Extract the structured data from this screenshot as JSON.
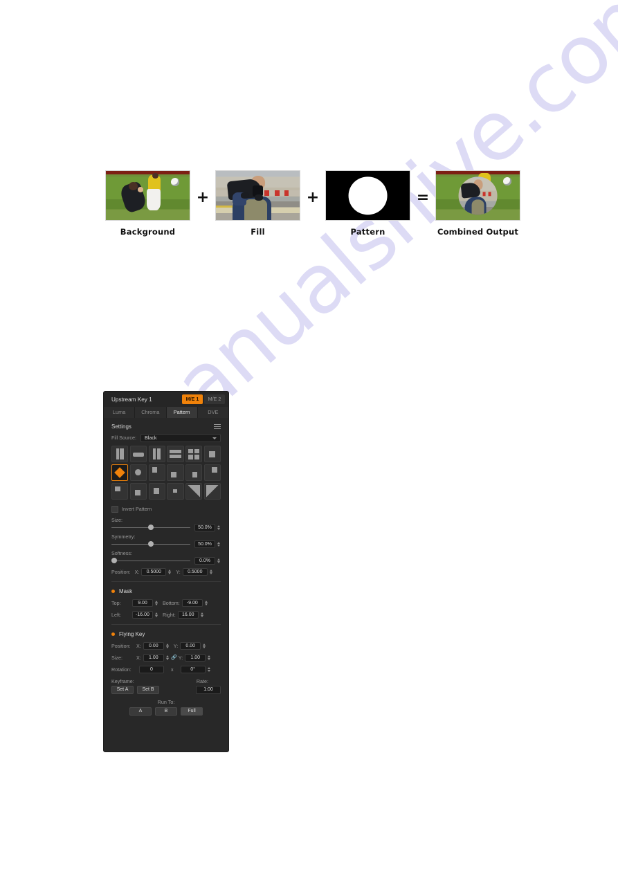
{
  "watermark": {
    "text": "manualshive.com"
  },
  "diagram": {
    "items": [
      {
        "caption": "Background",
        "image": "soccer-background-thumbnail"
      },
      {
        "caption": "Fill",
        "image": "cameraman-fill-thumbnail"
      },
      {
        "caption": "Pattern",
        "image": "circle-pattern-thumbnail"
      },
      {
        "caption": "Combined Output",
        "image": "combined-output-thumbnail"
      }
    ],
    "operators": [
      "+",
      "+",
      "="
    ]
  },
  "panel": {
    "title": "Upstream Key 1",
    "me_buttons": [
      {
        "label": "M/E 1",
        "active": true
      },
      {
        "label": "M/E 2",
        "active": false
      }
    ],
    "tabs": [
      {
        "label": "Luma",
        "active": false
      },
      {
        "label": "Chroma",
        "active": false
      },
      {
        "label": "Pattern",
        "active": true
      },
      {
        "label": "DVE",
        "active": false
      }
    ],
    "settings": {
      "heading": "Settings",
      "menu_icon": "hamburger-menu-icon",
      "fill_source_label": "Fill Source:",
      "fill_source_value": "Black",
      "invert_pattern_label": "Invert Pattern",
      "invert_pattern_checked": false,
      "selected_pattern_index": 6,
      "sliders": [
        {
          "label": "Size:",
          "value": "50.0%",
          "percent": 50
        },
        {
          "label": "Symmetry:",
          "value": "50.0%",
          "percent": 50
        },
        {
          "label": "Softness:",
          "value": "0.0%",
          "percent": 0
        }
      ],
      "position": {
        "label": "Position:",
        "x_label": "X:",
        "x_value": "0.5000",
        "y_label": "Y:",
        "y_value": "0.5000"
      }
    },
    "mask": {
      "title": "Mask",
      "top_label": "Top:",
      "top_value": "9.00",
      "bottom_label": "Bottom:",
      "bottom_value": "-9.00",
      "left_label": "Left:",
      "left_value": "-16.00",
      "right_label": "Right:",
      "right_value": "16.00"
    },
    "flying_key": {
      "title": "Flying Key",
      "position_label": "Position:",
      "position_x_label": "X:",
      "position_x_value": "0.00",
      "position_y_label": "Y:",
      "position_y_value": "0.00",
      "size_label": "Size:",
      "size_x_label": "X:",
      "size_x_value": "1.00",
      "size_y_label": "Y:",
      "size_y_value": "1.00",
      "link_icon": "link-chain-icon",
      "rotation_label": "Rotation:",
      "rotation_turns": "0",
      "rotation_times": "x",
      "rotation_degrees": "0°",
      "keyframe_label": "Keyframe:",
      "set_a_label": "Set A",
      "set_b_label": "Set B",
      "rate_label": "Rate:",
      "rate_value": "1:00",
      "run_to_label": "Run To:",
      "run_to_buttons": [
        {
          "label": "A",
          "highlight": false
        },
        {
          "label": "B",
          "highlight": false
        },
        {
          "label": "Full",
          "highlight": true
        }
      ]
    }
  },
  "colors": {
    "accent": "#f0820a",
    "panel_bg": "#282828",
    "panel_header_bg": "#262626",
    "tab_active_bg": "#383838",
    "field_bg": "#1a1a1a",
    "text": "#d6d6d6",
    "muted_text": "#989898",
    "watermark": "#c9c6ef"
  }
}
